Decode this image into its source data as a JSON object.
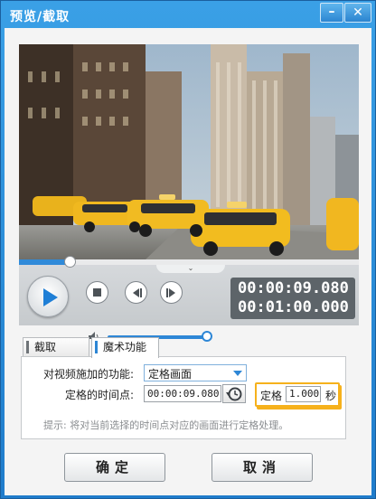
{
  "window": {
    "title": "预览/截取",
    "minimize_icon": "minimize-icon",
    "close_icon": "close-icon"
  },
  "player": {
    "seek_progress": 0.149,
    "volume_level": 0.93,
    "current_time": "00:00:09.080",
    "total_time": "00:01:00.000",
    "icons": [
      "play-icon",
      "stop-icon",
      "prev-frame-icon",
      "next-frame-icon",
      "volume-icon",
      "collapse-chevron-icon"
    ]
  },
  "tabs": [
    {
      "label": "截取",
      "active": false
    },
    {
      "label": "魔术功能",
      "active": true
    }
  ],
  "magic": {
    "function_label": "对视频施加的功能:",
    "function_value": "定格画面",
    "freeze_time_label": "定格的时间点:",
    "freeze_time_value": "00:00:09.080",
    "freeze_prefix": "定格",
    "freeze_duration": "1.000",
    "freeze_unit": "秒",
    "hint": "提示: 将对当前选择的时间点对应的画面进行定格处理。"
  },
  "buttons": {
    "ok": "确定",
    "cancel": "取消"
  },
  "colors": {
    "accent": "#2e87d6",
    "highlight": "#f6b11c",
    "title_bar": "#2a8ad8"
  }
}
